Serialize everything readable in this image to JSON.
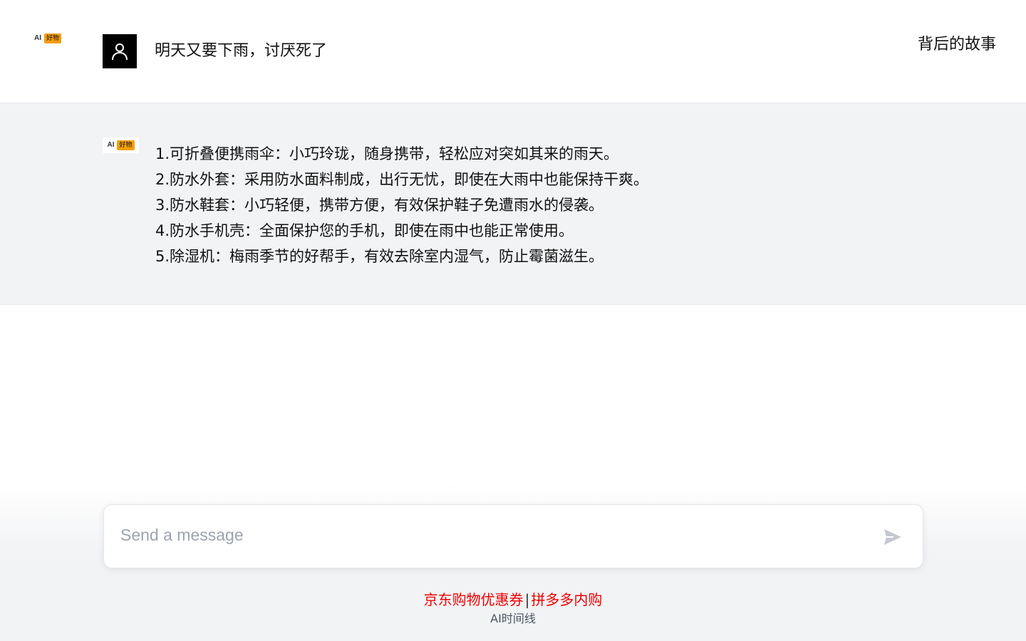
{
  "brand": {
    "ai_text": "AI",
    "badge_text": "好物",
    "badge_color": "#f59e0b"
  },
  "header": {
    "story_link": "背后的故事"
  },
  "conversation": {
    "user_message": "明天又要下雨，讨厌死了",
    "assistant_lines": [
      "1.可折叠便携雨伞：小巧玲珑，随身携带，轻松应对突如其来的雨天。",
      "2.防水外套：采用防水面料制成，出行无忧，即使在大雨中也能保持干爽。",
      "3.防水鞋套：小巧轻便，携带方便，有效保护鞋子免遭雨水的侵袭。",
      "4.防水手机壳：全面保护您的手机，即使在雨中也能正常使用。",
      "5.除湿机：梅雨季节的好帮手，有效去除室内湿气，防止霉菌滋生。"
    ]
  },
  "composer": {
    "placeholder": "Send a message",
    "send_icon": "send-icon"
  },
  "footer": {
    "link_jd": "京东购物优惠券",
    "separator": "|",
    "link_pdd": "拼多多内购",
    "sub_text": "AI时间线",
    "link_color": "#ee0000"
  }
}
